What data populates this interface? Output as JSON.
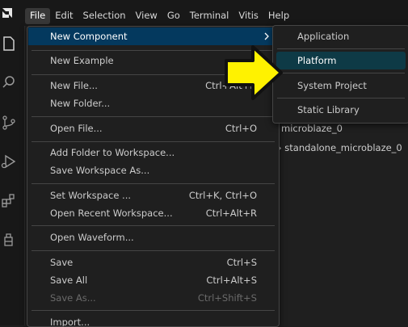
{
  "menubar": {
    "items": [
      {
        "label": "File",
        "active": true
      },
      {
        "label": "Edit"
      },
      {
        "label": "Selection"
      },
      {
        "label": "View"
      },
      {
        "label": "Go"
      },
      {
        "label": "Terminal"
      },
      {
        "label": "Vitis"
      },
      {
        "label": "Help"
      }
    ]
  },
  "file_menu": {
    "items": [
      {
        "label": "New Component",
        "shortcut": "",
        "has_submenu": true
      },
      {
        "label": "New Example",
        "shortcut": ""
      },
      {
        "label": "New File...",
        "shortcut": "Ctrl+Alt+N"
      },
      {
        "label": "New Folder...",
        "shortcut": ""
      },
      {
        "label": "Open File...",
        "shortcut": "Ctrl+O"
      },
      {
        "label": "Add Folder to Workspace...",
        "shortcut": ""
      },
      {
        "label": "Save Workspace As...",
        "shortcut": ""
      },
      {
        "label": "Set Workspace ...",
        "shortcut": "Ctrl+K, Ctrl+O"
      },
      {
        "label": "Open Recent Workspace...",
        "shortcut": "Ctrl+Alt+R"
      },
      {
        "label": "Open Waveform...",
        "shortcut": ""
      },
      {
        "label": "Save",
        "shortcut": "Ctrl+S"
      },
      {
        "label": "Save All",
        "shortcut": "Ctrl+Alt+S"
      },
      {
        "label": "Save As...",
        "shortcut": "Ctrl+Shift+S",
        "disabled": true
      },
      {
        "label": "Import...",
        "shortcut": ""
      }
    ]
  },
  "submenu": {
    "items": [
      {
        "label": "Application"
      },
      {
        "label": "Platform"
      },
      {
        "label": "System Project"
      },
      {
        "label": "Static Library"
      }
    ]
  },
  "explorer": {
    "rows": [
      {
        "label": "microblaze_0"
      },
      {
        "label": "standalone_microblaze_0"
      }
    ]
  },
  "colors": {
    "highlight": "#04395e",
    "submenu_highlight": "#0e3a46",
    "arrow": "#fff200"
  },
  "icons": [
    "amd-logo-icon",
    "explorer-icon",
    "search-icon",
    "source-control-icon",
    "run-debug-icon",
    "extensions-icon",
    "vitis-flask-icon",
    "chevron-right-icon"
  ]
}
